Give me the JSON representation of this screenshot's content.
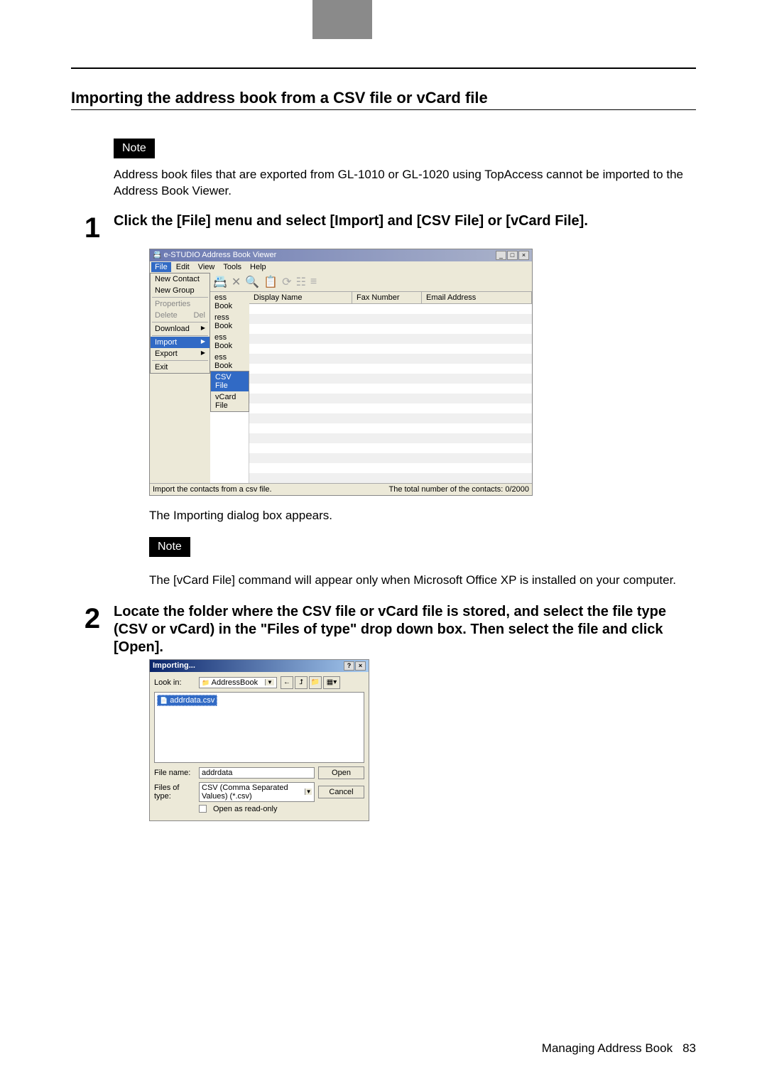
{
  "section": {
    "title": "Importing the address book from a CSV file or vCard file"
  },
  "note_label": "Note",
  "intro_note": "Address book files that are exported from GL-1010 or GL-1020 using TopAccess cannot be imported to the Address Book Viewer.",
  "step1": {
    "num": "1",
    "text": "Click the [File] menu and select [Import] and [CSV File] or [vCard File].",
    "caption": "The Importing dialog box appears."
  },
  "screenshot1": {
    "title": "e-STUDIO Address Book Viewer",
    "menubar": {
      "file": "File",
      "edit": "Edit",
      "view": "View",
      "tools": "Tools",
      "help": "Help"
    },
    "file_menu": {
      "new_contact": "New Contact",
      "new_group": "New Group",
      "properties": "Properties",
      "delete": "Delete",
      "del": "Del",
      "download": "Download",
      "import": "Import",
      "export": "Export",
      "exit": "Exit"
    },
    "tree": {
      "item1": "ess Book",
      "item2": "ress Book",
      "item3": "ess Book",
      "item4": "ess Book"
    },
    "submenu": {
      "csv": "CSV File",
      "vcard": "vCard File"
    },
    "columns": {
      "display": "Display Name",
      "fax": "Fax Number",
      "email": "Email Address"
    },
    "status_left": "Import the contacts from a csv file.",
    "status_right": "The total number of the contacts: 0/2000"
  },
  "note2": "The [vCard File] command will appear only when Microsoft Office XP is installed on your computer.",
  "step2": {
    "num": "2",
    "text": "Locate the folder where the CSV file or vCard file is stored, and select the file type (CSV or vCard) in the \"Files of type\" drop down box. Then select the file and click [Open]."
  },
  "screenshot2": {
    "title": "Importing...",
    "look_in_label": "Look in:",
    "look_in_value": "AddressBook",
    "file_selected": "addrdata.csv",
    "filename_label": "File name:",
    "filename_value": "addrdata",
    "filetype_label": "Files of type:",
    "filetype_value": "CSV (Comma Separated Values) (*.csv)",
    "readonly_label": "Open as read-only",
    "open_btn": "Open",
    "cancel_btn": "Cancel"
  },
  "footer": {
    "text": "Managing Address Book",
    "page": "83"
  }
}
